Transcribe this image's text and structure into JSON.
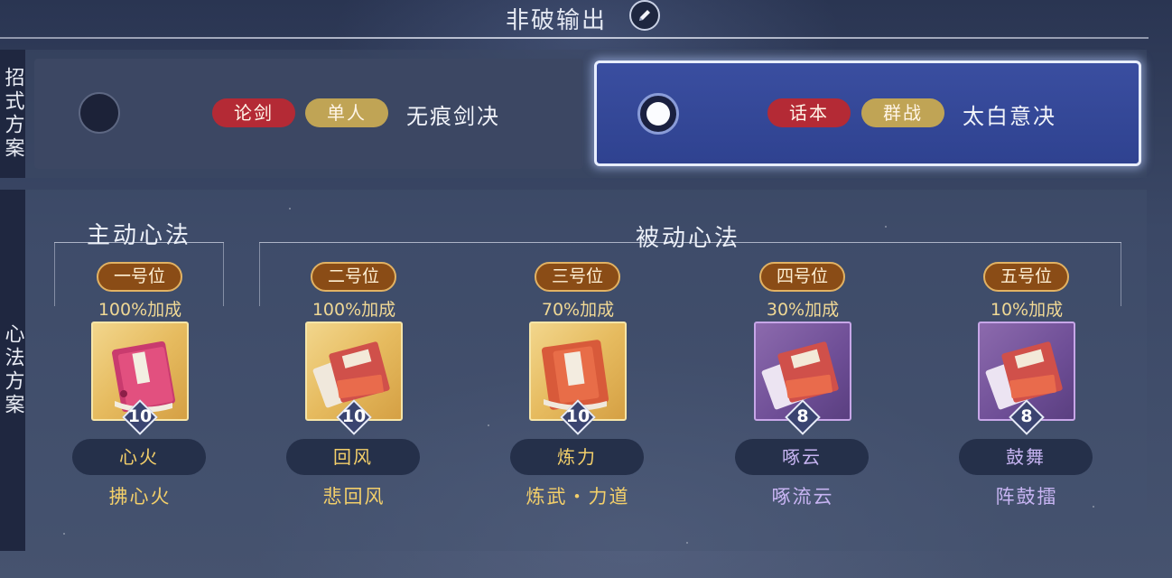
{
  "header": {
    "title": "非破输出",
    "edit_icon": "pencil-icon"
  },
  "side_labels": {
    "skill_plan": "招式方案",
    "xinfa_plan": "心法方案"
  },
  "skill_plans": [
    {
      "selected": false,
      "tags": [
        "论剑",
        "单人"
      ],
      "name": "无痕剑决"
    },
    {
      "selected": true,
      "tags": [
        "话本",
        "群战"
      ],
      "name": "太白意决"
    }
  ],
  "sections": {
    "active": "主动心法",
    "passive": "被动心法"
  },
  "slots": [
    {
      "position": "一号位",
      "bonus": "100%加成",
      "level": "10",
      "skill": "心火",
      "sub": "拂心火",
      "rarity": "gold",
      "colors": {
        "accent": "#f3cf6a"
      }
    },
    {
      "position": "二号位",
      "bonus": "100%加成",
      "level": "10",
      "skill": "回风",
      "sub": "悲回风",
      "rarity": "gold",
      "colors": {
        "accent": "#f3cf6a"
      }
    },
    {
      "position": "三号位",
      "bonus": "70%加成",
      "level": "10",
      "skill": "炼力",
      "sub": "炼武・力道",
      "rarity": "gold",
      "colors": {
        "accent": "#f3cf6a"
      }
    },
    {
      "position": "四号位",
      "bonus": "30%加成",
      "level": "8",
      "skill": "啄云",
      "sub": "啄流云",
      "rarity": "purple",
      "colors": {
        "accent": "#c7b4f2"
      }
    },
    {
      "position": "五号位",
      "bonus": "10%加成",
      "level": "8",
      "skill": "鼓舞",
      "sub": "阵鼓擂",
      "rarity": "purple",
      "colors": {
        "accent": "#c7b4f2"
      }
    }
  ]
}
